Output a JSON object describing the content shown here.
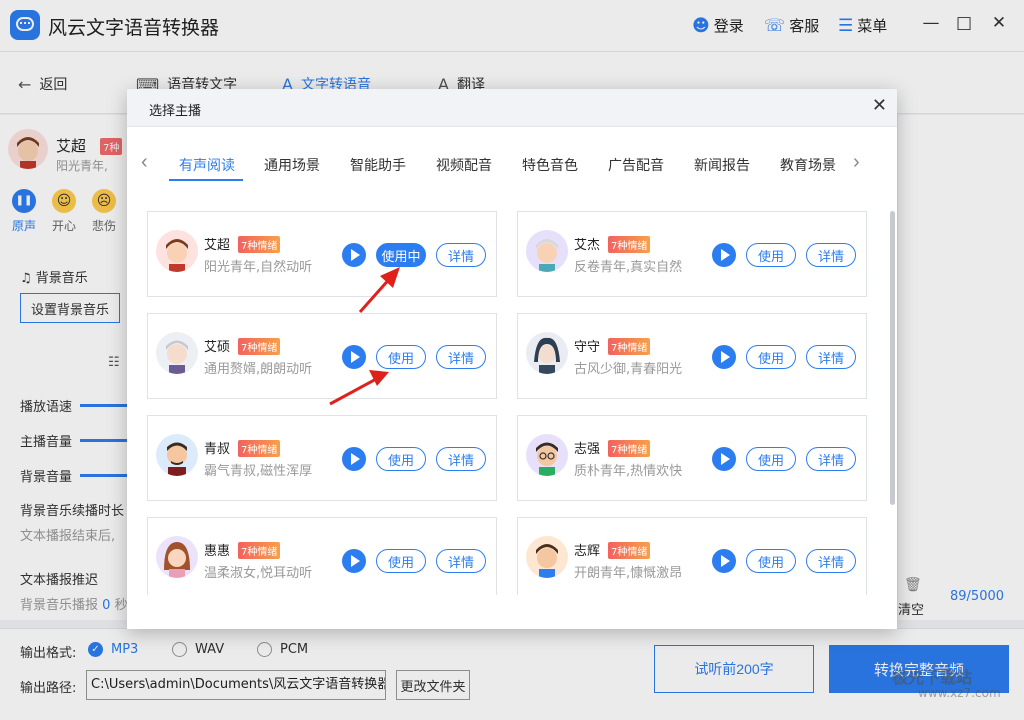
{
  "app": {
    "title": "风云文字语音转换器",
    "login": "登录",
    "service": "客服",
    "menu": "菜单"
  },
  "nav": {
    "back": "返回",
    "speech_to_text": "语音转文字",
    "text_to_speech": "文字转语音",
    "translate": "翻译"
  },
  "left": {
    "anchor_name": "艾超",
    "anchor_badge": "7种",
    "anchor_desc": "阳光青年,",
    "emotions": [
      "原声",
      "开心",
      "悲伤"
    ],
    "bgm_title": "背景音乐",
    "bgm_button": "设置背景音乐",
    "speed_label": "播放语速",
    "anchor_volume_label": "主播音量",
    "bgm_volume_label": "背景音量",
    "bgm_duration_label": "背景音乐续播时长",
    "bgm_after_text": "文本播报结束后,",
    "delay_label": "文本播报推迟",
    "delay_text": "背景音乐播报",
    "delay_value": "0",
    "delay_unit": "秒"
  },
  "right": {
    "clear": "清空",
    "counter": "89/5000"
  },
  "bottom": {
    "format_label": "输出格式:",
    "formats": [
      "MP3",
      "WAV",
      "PCM"
    ],
    "selected_format": "MP3",
    "path_label": "输出路径:",
    "path_value": "C:\\Users\\admin\\Documents\\风云文字语音转换器",
    "change_folder": "更改文件夹",
    "listen_button": "试听前200字",
    "convert_button": "转换完整音频"
  },
  "modal": {
    "title": "选择主播",
    "tabs": [
      "有声阅读",
      "通用场景",
      "智能助手",
      "视频配音",
      "特色音色",
      "广告配音",
      "新闻报告",
      "教育场景"
    ],
    "active_tab": "有声阅读",
    "badge_text": "7种情绪",
    "use_label": "使用",
    "in_use_label": "使用中",
    "detail_label": "详情",
    "voices": [
      {
        "name": "艾超",
        "desc": "阳光青年,自然动听",
        "in_use": true
      },
      {
        "name": "艾杰",
        "desc": "反卷青年,真实自然",
        "in_use": false
      },
      {
        "name": "艾硕",
        "desc": "通用赘婿,朗朗动听",
        "in_use": false
      },
      {
        "name": "守守",
        "desc": "古风少御,青春阳光",
        "in_use": false
      },
      {
        "name": "青叔",
        "desc": "霸气青叔,磁性浑厚",
        "in_use": false
      },
      {
        "name": "志强",
        "desc": "质朴青年,热情欢快",
        "in_use": false
      },
      {
        "name": "惠惠",
        "desc": "温柔淑女,悦耳动听",
        "in_use": false
      },
      {
        "name": "志辉",
        "desc": "开朗青年,慷慨激昂",
        "in_use": false
      }
    ]
  },
  "watermark": {
    "line1": "极光下载站",
    "line2": "www.xz7.com"
  },
  "colors": {
    "accent": "#2c7df0",
    "arrow": "#e0201b"
  }
}
